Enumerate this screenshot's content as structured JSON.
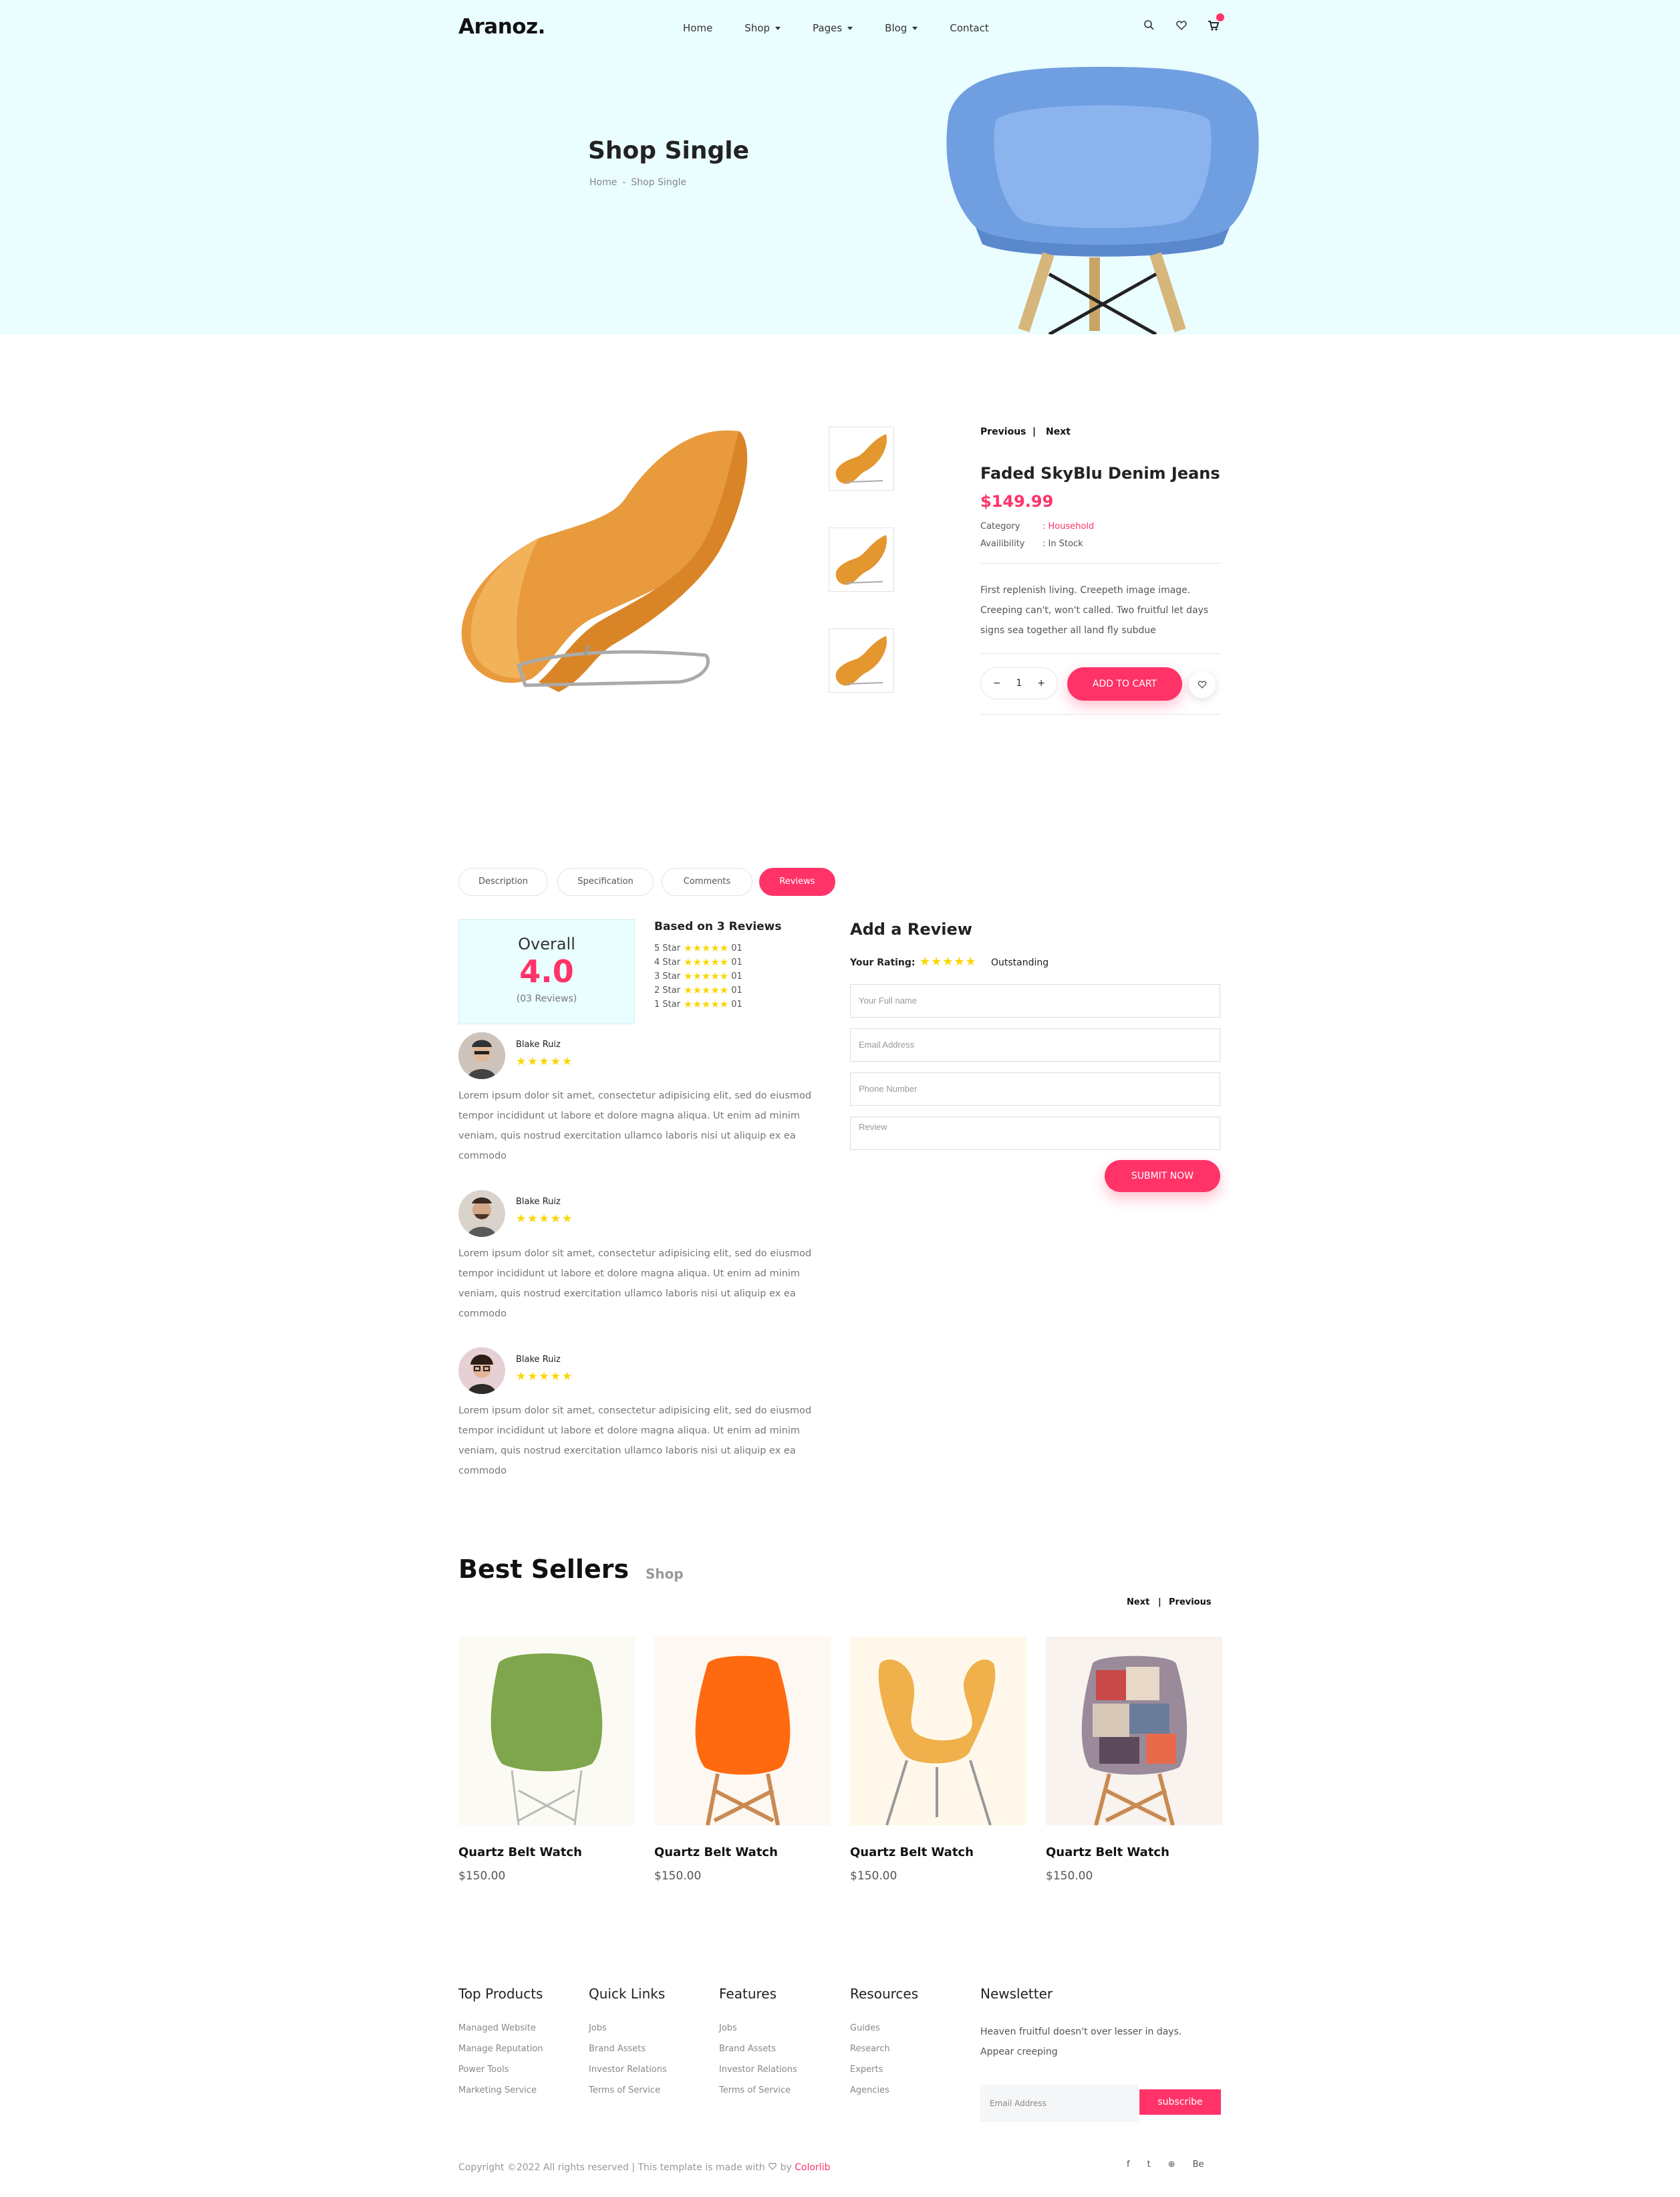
{
  "brand": "Aranoz.",
  "nav": [
    {
      "label": "Home",
      "dropdown": false
    },
    {
      "label": "Shop",
      "dropdown": true
    },
    {
      "label": "Pages",
      "dropdown": true
    },
    {
      "label": "Blog",
      "dropdown": true
    },
    {
      "label": "Contact",
      "dropdown": false
    }
  ],
  "header_icons": [
    "search-icon",
    "heart-icon",
    "cart-icon"
  ],
  "hero": {
    "title": "Shop Single",
    "breadcrumb": [
      "Home",
      "-",
      "Shop Single"
    ]
  },
  "product": {
    "prev_label": "Previous",
    "separator": "|",
    "next_label": "Next",
    "title": "Faded SkyBlu Denim Jeans",
    "price": "$149.99",
    "category_label": "Category",
    "category_value": ": Household",
    "availability_label": "Availibility",
    "availability_value": ": In Stock",
    "description": "First replenish living. Creepeth image image. Creeping can't, won't called. Two fruitful let days signs sea together all land fly subdue",
    "qty_minus": "−",
    "quantity": "1",
    "qty_plus": "+",
    "add_to_cart": "ADD TO CART"
  },
  "tabs": [
    {
      "label": "Description",
      "active": false
    },
    {
      "label": "Specification",
      "active": false
    },
    {
      "label": "Comments",
      "active": false
    },
    {
      "label": "Reviews",
      "active": true
    }
  ],
  "reviews_summary": {
    "overall_label": "Overall",
    "overall_value": "4.0",
    "review_count": "(03 Reviews)",
    "based_on": "Based on 3 Reviews",
    "rows": [
      {
        "label": "5 Star",
        "stars": "★★★★★",
        "count": "01"
      },
      {
        "label": "4 Star",
        "stars": "★★★★★",
        "count": "01"
      },
      {
        "label": "3 Star",
        "stars": "★★★★★",
        "count": "01"
      },
      {
        "label": "2 Star",
        "stars": "★★★★★",
        "count": "01"
      },
      {
        "label": "1 Star",
        "stars": "★★★★★",
        "count": "01"
      }
    ]
  },
  "reviews": [
    {
      "name": "Blake Ruiz",
      "stars": "★★★★★",
      "text": "Lorem ipsum dolor sit amet, consectetur adipisicing elit, sed do eiusmod tempor incididunt ut labore et dolore magna aliqua. Ut enim ad minim veniam, quis nostrud exercitation ullamco laboris nisi ut aliquip ex ea commodo"
    },
    {
      "name": "Blake Ruiz",
      "stars": "★★★★★",
      "text": "Lorem ipsum dolor sit amet, consectetur adipisicing elit, sed do eiusmod tempor incididunt ut labore et dolore magna aliqua. Ut enim ad minim veniam, quis nostrud exercitation ullamco laboris nisi ut aliquip ex ea commodo"
    },
    {
      "name": "Blake Ruiz",
      "stars": "★★★★★",
      "text": "Lorem ipsum dolor sit amet, consectetur adipisicing elit, sed do eiusmod tempor incididunt ut labore et dolore magna aliqua. Ut enim ad minim veniam, quis nostrud exercitation ullamco laboris nisi ut aliquip ex ea commodo"
    }
  ],
  "review_form": {
    "title": "Add a Review",
    "rating_label": "Your Rating:",
    "rating_stars": "★★★★★",
    "rating_word": "Outstanding",
    "name_placeholder": "Your Full name",
    "email_placeholder": "Email Address",
    "phone_placeholder": "Phone Number",
    "review_placeholder": "Review",
    "submit": "SUBMIT NOW"
  },
  "best_sellers": {
    "title": "Best Sellers",
    "subtitle": "Shop",
    "next_label": "Next",
    "separator": "|",
    "prev_label": "Previous",
    "items": [
      {
        "name": "Quartz Belt Watch",
        "price": "$150.00",
        "color": "#7fa64c"
      },
      {
        "name": "Quartz Belt Watch",
        "price": "$150.00",
        "color": "#ff6a10"
      },
      {
        "name": "Quartz Belt Watch",
        "price": "$150.00",
        "color": "#f0b04c"
      },
      {
        "name": "Quartz Belt Watch",
        "price": "$150.00",
        "color": "#9a8a9a"
      }
    ]
  },
  "footer": {
    "columns": [
      {
        "title": "Top Products",
        "links": [
          "Managed Website",
          "Manage Reputation",
          "Power Tools",
          "Marketing Service"
        ]
      },
      {
        "title": "Quick Links",
        "links": [
          "Jobs",
          "Brand Assets",
          "Investor Relations",
          "Terms of Service"
        ]
      },
      {
        "title": "Features",
        "links": [
          "Jobs",
          "Brand Assets",
          "Investor Relations",
          "Terms of Service"
        ]
      },
      {
        "title": "Resources",
        "links": [
          "Guides",
          "Research",
          "Experts",
          "Agencies"
        ]
      }
    ],
    "newsletter_title": "Newsletter",
    "newsletter_text": "Heaven fruitful doesn't over lesser in days. Appear creeping",
    "email_placeholder": "Email Address",
    "subscribe": "subscribe",
    "copyright_prefix": "Copyright ©2022 All rights reserved | This template is made with",
    "copyright_by": "by",
    "copyright_link": "Colorlib",
    "socials": [
      "f",
      "t",
      "⊕",
      "Be"
    ]
  },
  "colors": {
    "accent": "#ff3368",
    "hero_bg": "#eafdff",
    "star": "#fbd600"
  }
}
